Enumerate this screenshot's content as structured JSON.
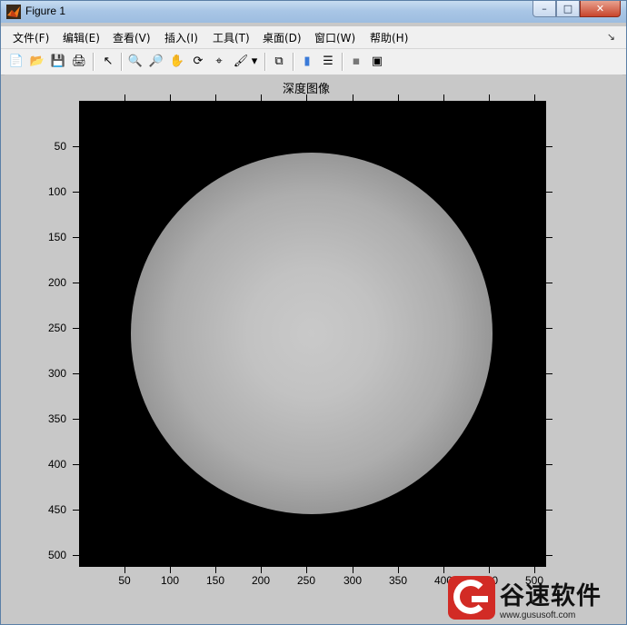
{
  "window": {
    "title": "Figure 1"
  },
  "menu": [
    "文件(F)",
    "编辑(E)",
    "查看(V)",
    "插入(I)",
    "工具(T)",
    "桌面(D)",
    "窗口(W)",
    "帮助(H)"
  ],
  "window_buttons": {
    "min": "–",
    "max": "□",
    "close": "✕"
  },
  "toolbar": [
    {
      "name": "new-figure-icon",
      "glyph": "📄"
    },
    {
      "name": "open-file-icon",
      "glyph": "📂"
    },
    {
      "name": "save-icon",
      "glyph": "💾"
    },
    {
      "name": "print-icon",
      "glyph": "🖨"
    },
    {
      "name": "edit-plot-icon",
      "glyph": "↖"
    },
    {
      "name": "zoom-in-icon",
      "glyph": "🔍"
    },
    {
      "name": "zoom-out-icon",
      "glyph": "🔎"
    },
    {
      "name": "pan-icon",
      "glyph": "✋"
    },
    {
      "name": "rotate-3d-icon",
      "glyph": "⟳"
    },
    {
      "name": "data-cursor-icon",
      "glyph": "⌖"
    },
    {
      "name": "brush-icon",
      "glyph": "🖌"
    },
    {
      "name": "brush-dropdown-icon",
      "glyph": "▾"
    },
    {
      "name": "link-plot-icon",
      "glyph": "⧉"
    },
    {
      "name": "colorbar-icon",
      "glyph": "▮"
    },
    {
      "name": "legend-icon",
      "glyph": "☰"
    },
    {
      "name": "hide-plot-tools-icon",
      "glyph": "▪"
    },
    {
      "name": "show-plot-tools-icon",
      "glyph": "▣"
    }
  ],
  "plot": {
    "title": "深度图像"
  },
  "axes": {
    "y_ticks": [
      "50",
      "100",
      "150",
      "200",
      "250",
      "300",
      "350",
      "400",
      "450",
      "500"
    ],
    "x_ticks": [
      "50",
      "100",
      "150",
      "200",
      "250",
      "300",
      "350",
      "400",
      "450",
      "500"
    ],
    "xlim": [
      0.5,
      512.5
    ],
    "ylim": [
      0.5,
      512.5
    ],
    "y_reversed": true
  },
  "image": {
    "type": "grayscale-sphere-depth-map",
    "background": "#000000",
    "sphere_center": [
      256,
      260
    ],
    "sphere_radius": 199
  },
  "watermark": {
    "text": "谷速软件",
    "url": "www.gususoft.com",
    "color": "#d22b25"
  }
}
